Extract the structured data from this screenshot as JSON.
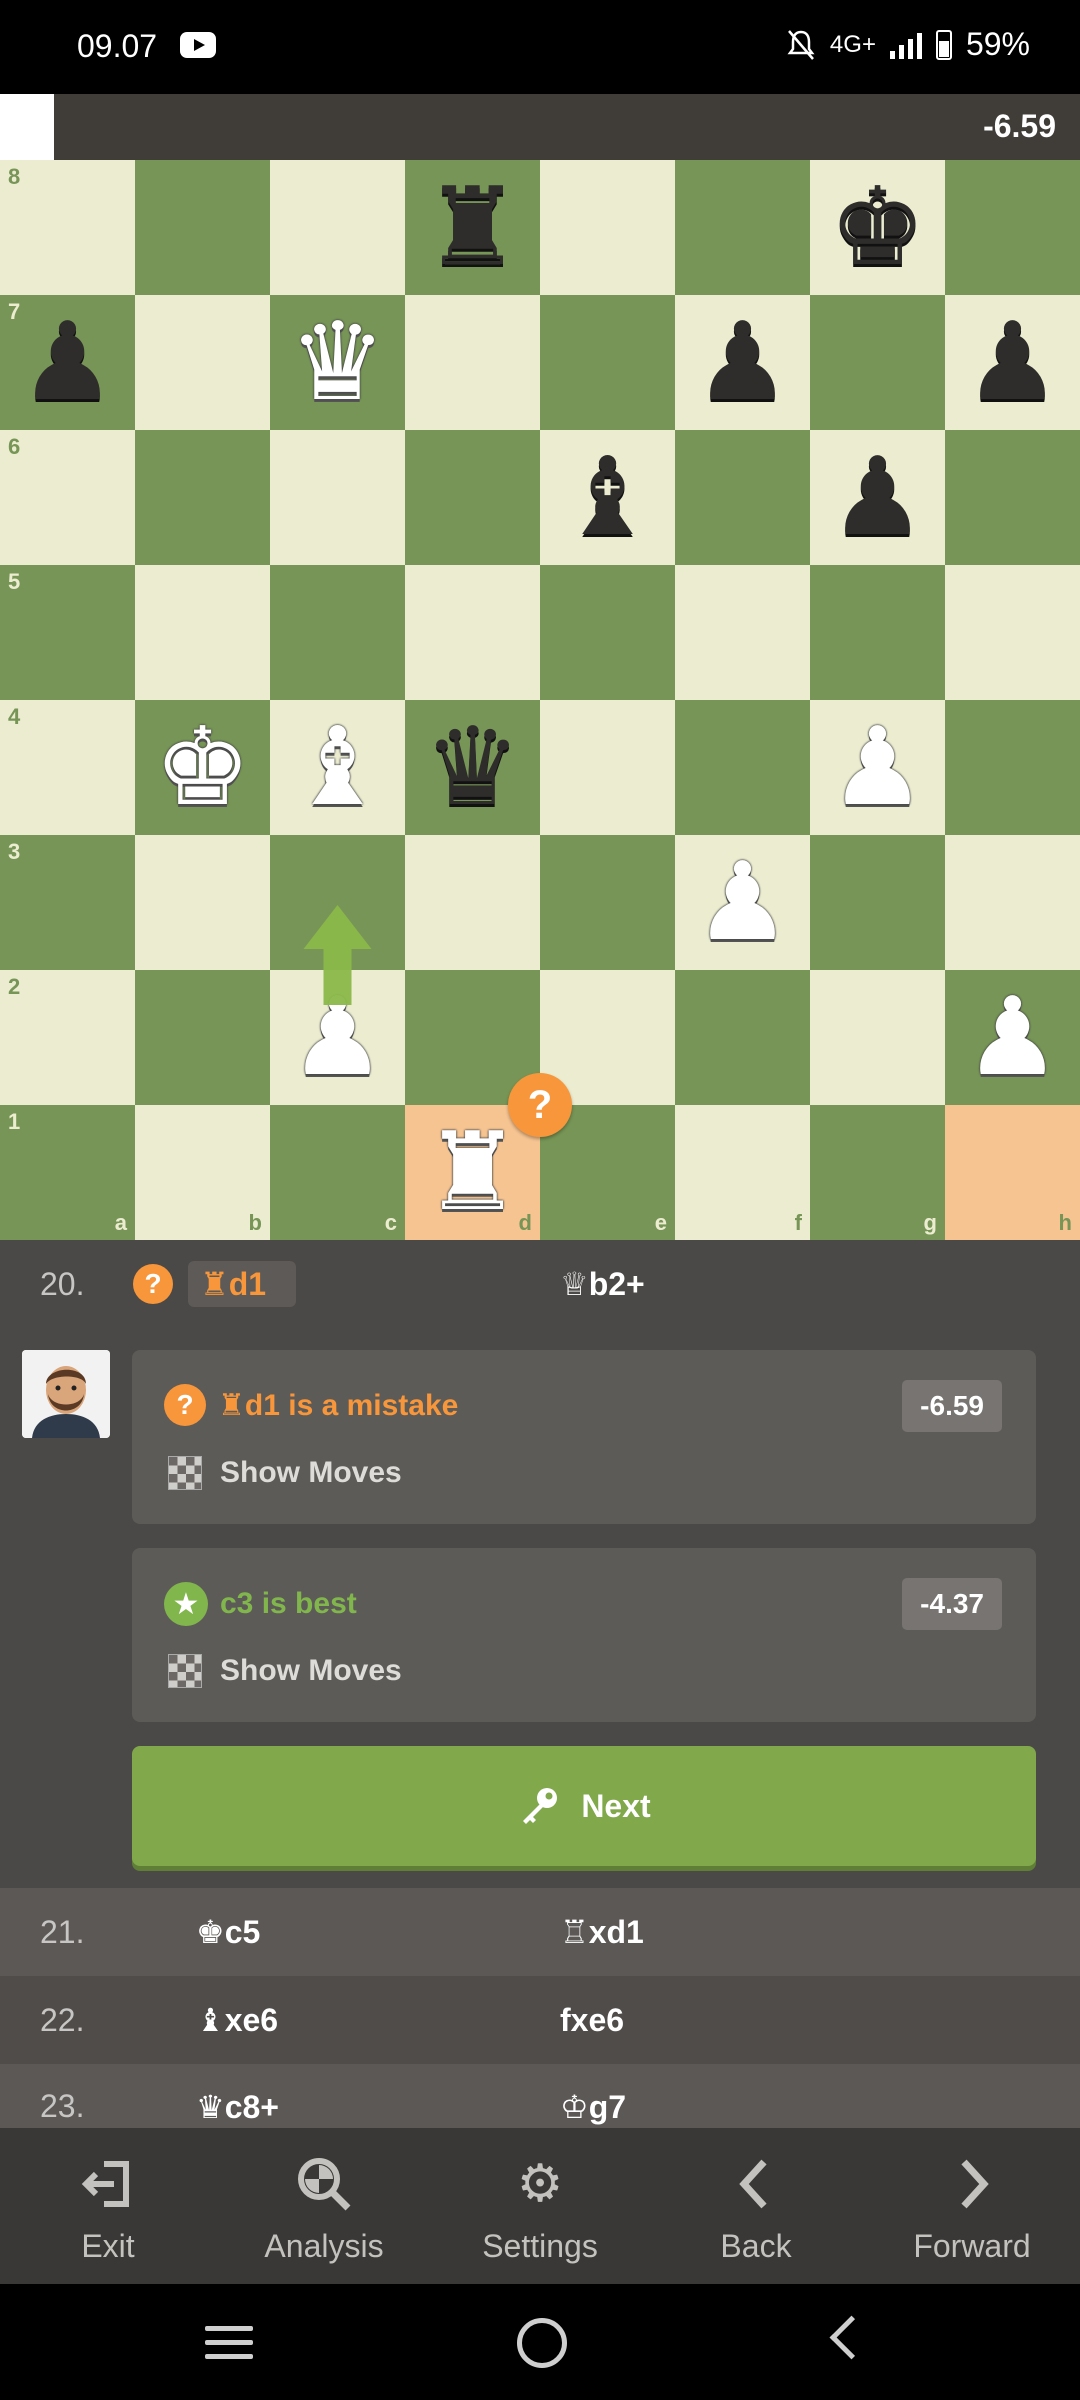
{
  "status_bar": {
    "time": "09.07",
    "network": "4G+",
    "battery": "59%"
  },
  "eval_bar": {
    "value": "-6.59",
    "white_fraction": 0.05
  },
  "board": {
    "ranks": [
      "8",
      "7",
      "6",
      "5",
      "4",
      "3",
      "2",
      "1"
    ],
    "files": [
      "a",
      "b",
      "c",
      "d",
      "e",
      "f",
      "g",
      "h"
    ],
    "highlighted_squares": [
      "d1",
      "h1"
    ],
    "arrow": {
      "from": "c2",
      "to": "c3"
    },
    "mistake_marker_square": "d1",
    "pieces": [
      {
        "square": "d8",
        "glyph": "♜",
        "color": "b",
        "name": "black-rook"
      },
      {
        "square": "g8",
        "glyph": "♚",
        "color": "b",
        "name": "black-king"
      },
      {
        "square": "a7",
        "glyph": "♟",
        "color": "b",
        "name": "black-pawn"
      },
      {
        "square": "c7",
        "glyph": "♛",
        "color": "w",
        "name": "white-queen"
      },
      {
        "square": "f7",
        "glyph": "♟",
        "color": "b",
        "name": "black-pawn"
      },
      {
        "square": "h7",
        "glyph": "♟",
        "color": "b",
        "name": "black-pawn"
      },
      {
        "square": "e6",
        "glyph": "♝",
        "color": "b",
        "name": "black-bishop"
      },
      {
        "square": "g6",
        "glyph": "♟",
        "color": "b",
        "name": "black-pawn"
      },
      {
        "square": "b4",
        "glyph": "♚",
        "color": "w",
        "name": "white-king"
      },
      {
        "square": "c4",
        "glyph": "♝",
        "color": "w",
        "name": "white-bishop"
      },
      {
        "square": "d4",
        "glyph": "♛",
        "color": "b",
        "name": "black-queen"
      },
      {
        "square": "g4",
        "glyph": "♟",
        "color": "w",
        "name": "white-pawn"
      },
      {
        "square": "f3",
        "glyph": "♟",
        "color": "w",
        "name": "white-pawn"
      },
      {
        "square": "c2",
        "glyph": "♟",
        "color": "w",
        "name": "white-pawn"
      },
      {
        "square": "h2",
        "glyph": "♟",
        "color": "w",
        "name": "white-pawn"
      },
      {
        "square": "d1",
        "glyph": "♜",
        "color": "w",
        "name": "white-rook"
      }
    ]
  },
  "moves": {
    "row20": {
      "num": "20.",
      "white": "♜d1",
      "black": "♕b2+"
    },
    "row21": {
      "num": "21.",
      "white": "♚c5",
      "black": "♖xd1"
    },
    "row22": {
      "num": "22.",
      "white": "♝xe6",
      "black": "fxe6"
    },
    "row23": {
      "num": "23.",
      "white": "♛c8+",
      "black": "♔g7"
    }
  },
  "coach": {
    "mistake": {
      "text": "♜d1 is a mistake",
      "eval": "-6.59",
      "show_moves": "Show Moves"
    },
    "best": {
      "text": "c3 is best",
      "eval": "-4.37",
      "show_moves": "Show Moves"
    },
    "next_label": "Next"
  },
  "toolbar": {
    "exit": "Exit",
    "analysis": "Analysis",
    "settings": "Settings",
    "back": "Back",
    "forward": "Forward"
  },
  "colors": {
    "light_square": "#ebecd0",
    "dark_square": "#779556",
    "highlight": "#f6c491",
    "mistake": "#f7963a",
    "best": "#81b64c"
  }
}
